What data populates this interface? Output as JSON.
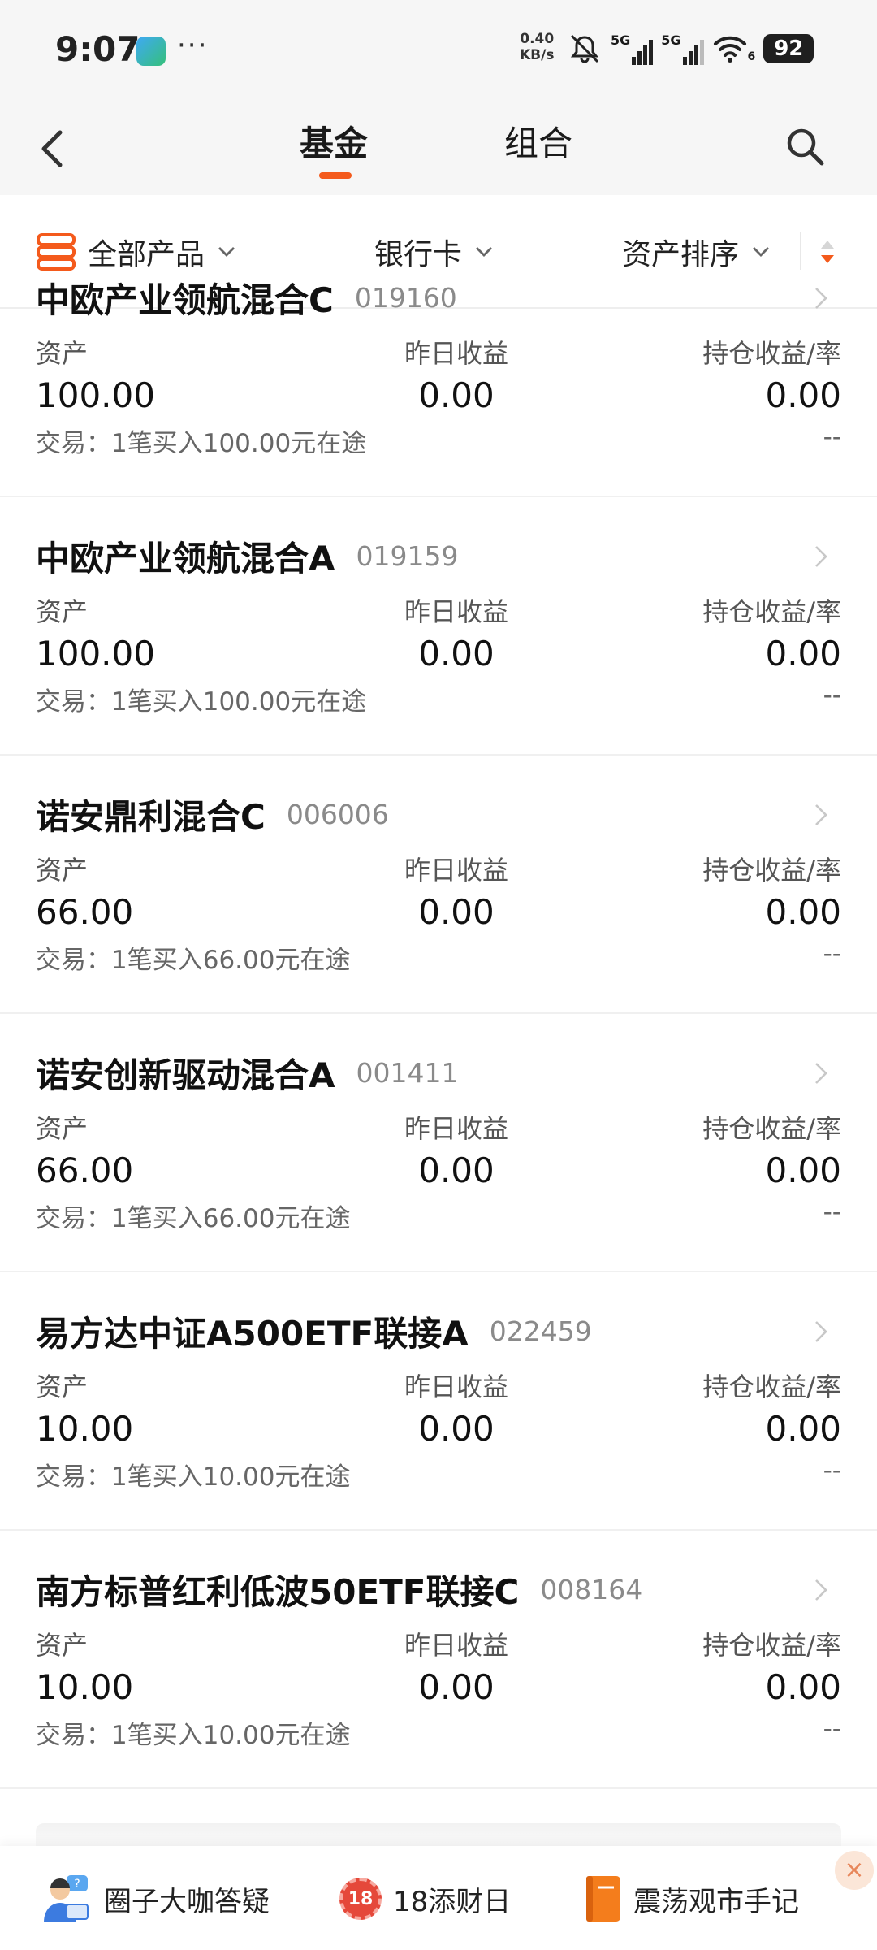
{
  "status_bar": {
    "time": "9:07",
    "dots": "···",
    "net_speed_value": "0.40",
    "net_speed_unit": "KB/s",
    "signal1_label": "5G",
    "signal2_label": "5G",
    "wifi_label": "6",
    "battery": "92"
  },
  "header": {
    "tabs": [
      {
        "label": "基金",
        "active": true
      },
      {
        "label": "组合",
        "active": false
      }
    ],
    "accent_color": "#f45a1c"
  },
  "filters": {
    "all_products": "全部产品",
    "bank_card": "银行卡",
    "asset_sort": "资产排序"
  },
  "labels": {
    "assets": "资产",
    "yesterday_income": "昨日收益",
    "holding_income": "持仓收益/率"
  },
  "funds": [
    {
      "name": "中欧产业领航混合C",
      "code": "019160",
      "assets": "100.00",
      "yesterday": "0.00",
      "holding": "0.00",
      "trade": "交易：1笔买入100.00元在途",
      "rate": "--"
    },
    {
      "name": "中欧产业领航混合A",
      "code": "019159",
      "assets": "100.00",
      "yesterday": "0.00",
      "holding": "0.00",
      "trade": "交易：1笔买入100.00元在途",
      "rate": "--"
    },
    {
      "name": "诺安鼎利混合C",
      "code": "006006",
      "assets": "66.00",
      "yesterday": "0.00",
      "holding": "0.00",
      "trade": "交易：1笔买入66.00元在途",
      "rate": "--"
    },
    {
      "name": "诺安创新驱动混合A",
      "code": "001411",
      "assets": "66.00",
      "yesterday": "0.00",
      "holding": "0.00",
      "trade": "交易：1笔买入66.00元在途",
      "rate": "--"
    },
    {
      "name": "易方达中证A500ETF联接A",
      "code": "022459",
      "assets": "10.00",
      "yesterday": "0.00",
      "holding": "0.00",
      "trade": "交易：1笔买入10.00元在途",
      "rate": "--"
    },
    {
      "name": "南方标普红利低波50ETF联接C",
      "code": "008164",
      "assets": "10.00",
      "yesterday": "0.00",
      "holding": "0.00",
      "trade": "交易：1笔买入10.00元在途",
      "rate": "--"
    }
  ],
  "bottom_bar": {
    "items": [
      {
        "label": "圈子大咖答疑",
        "icon": "expert-icon"
      },
      {
        "label": "18添财日",
        "icon": "badge-18-icon",
        "badge_text": "18"
      },
      {
        "label": "震荡观市手记",
        "icon": "notebook-icon"
      }
    ],
    "close_symbol": "×"
  }
}
